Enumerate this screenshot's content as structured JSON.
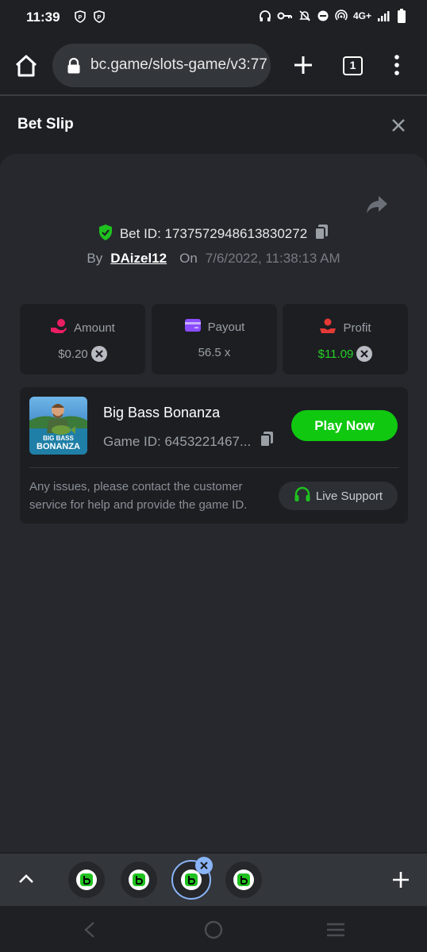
{
  "status_bar": {
    "time": "11:39",
    "network": "4G+"
  },
  "browser": {
    "url": "bc.game/slots-game/v3:77",
    "tab_count": "1"
  },
  "header": {
    "title": "Bet Slip"
  },
  "bet": {
    "id_label": "Bet ID: 1737572948613830272",
    "by_label": "By",
    "user": "DAizel12",
    "on_label": "On",
    "date": "7/6/2022, 11:38:13 AM"
  },
  "stats": [
    {
      "label": "Amount",
      "value": "$0.20",
      "color": "#9aa0a6"
    },
    {
      "label": "Payout",
      "value": "56.5 x",
      "color": "#9aa0a6"
    },
    {
      "label": "Profit",
      "value": "$11.09",
      "color": "#26d026"
    }
  ],
  "game": {
    "name": "Big Bass Bonanza",
    "id_label": "Game ID: 6453221467...",
    "thumb_text_1": "BIG BASS",
    "thumb_text_2": "BONANZA",
    "play_label": "Play Now"
  },
  "support": {
    "text": "Any issues, please contact the customer service for help and provide the game ID.",
    "button_label": "Live Support"
  },
  "colors": {
    "accent_green": "#10c810",
    "profit_green": "#26d026",
    "amount_icon": "#e91e63",
    "payout_icon": "#8b4dff",
    "profit_icon": "#e53935"
  },
  "icons": {
    "amount": "hand-coin-icon",
    "payout": "wallet-icon",
    "profit": "person-money-icon",
    "verified": "shield-check-icon",
    "copy": "copy-icon",
    "share": "share-icon",
    "headset": "headset-icon"
  }
}
